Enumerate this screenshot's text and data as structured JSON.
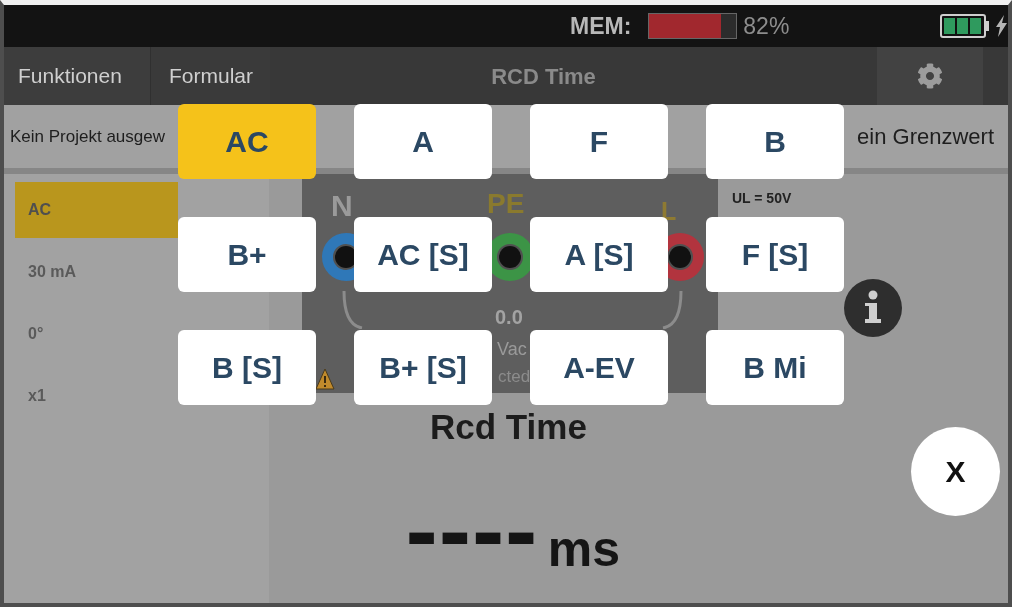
{
  "status_bar": {
    "memory_label": "MEM:",
    "memory": {
      "level": 0.82
    },
    "memory_reading": "82%"
  },
  "nav_bar": {
    "tabs": [
      {
        "label": "Funktionen"
      },
      {
        "label": "Formular"
      }
    ],
    "title": "RCD Time"
  },
  "info_row": {
    "project": "Kein Projekt ausgew",
    "limit": "ein Grenzwert"
  },
  "sidebar": {
    "items": [
      {
        "label": "AC",
        "selected": true
      },
      {
        "label": "30 mA",
        "selected": false
      },
      {
        "label": "0°",
        "selected": false
      },
      {
        "label": "x1",
        "selected": false
      }
    ]
  },
  "diagram": {
    "terminals": [
      {
        "label": "N",
        "color": "#2f78b8"
      },
      {
        "label": "PE",
        "color": "#3c9446"
      },
      {
        "label": "L",
        "color": "#b2343e"
      }
    ],
    "reading": "0.0",
    "unit": "Vac",
    "status_text": "cted"
  },
  "limit_label": "UL = 50V",
  "measurement": {
    "name": "Rcd Time",
    "value": "----",
    "unit": "ms"
  },
  "type_picker": {
    "options": [
      {
        "label": "AC",
        "selected": true
      },
      {
        "label": "A",
        "selected": false
      },
      {
        "label": "F",
        "selected": false
      },
      {
        "label": "B",
        "selected": false
      },
      {
        "label": "B+",
        "selected": false
      },
      {
        "label": "AC [S]",
        "selected": false
      },
      {
        "label": "A [S]",
        "selected": false
      },
      {
        "label": "F [S]",
        "selected": false
      },
      {
        "label": "B [S]",
        "selected": false
      },
      {
        "label": "B+ [S]",
        "selected": false
      },
      {
        "label": "A-EV",
        "selected": false
      },
      {
        "label": "B Mi",
        "selected": false
      }
    ],
    "close_label": "X"
  }
}
